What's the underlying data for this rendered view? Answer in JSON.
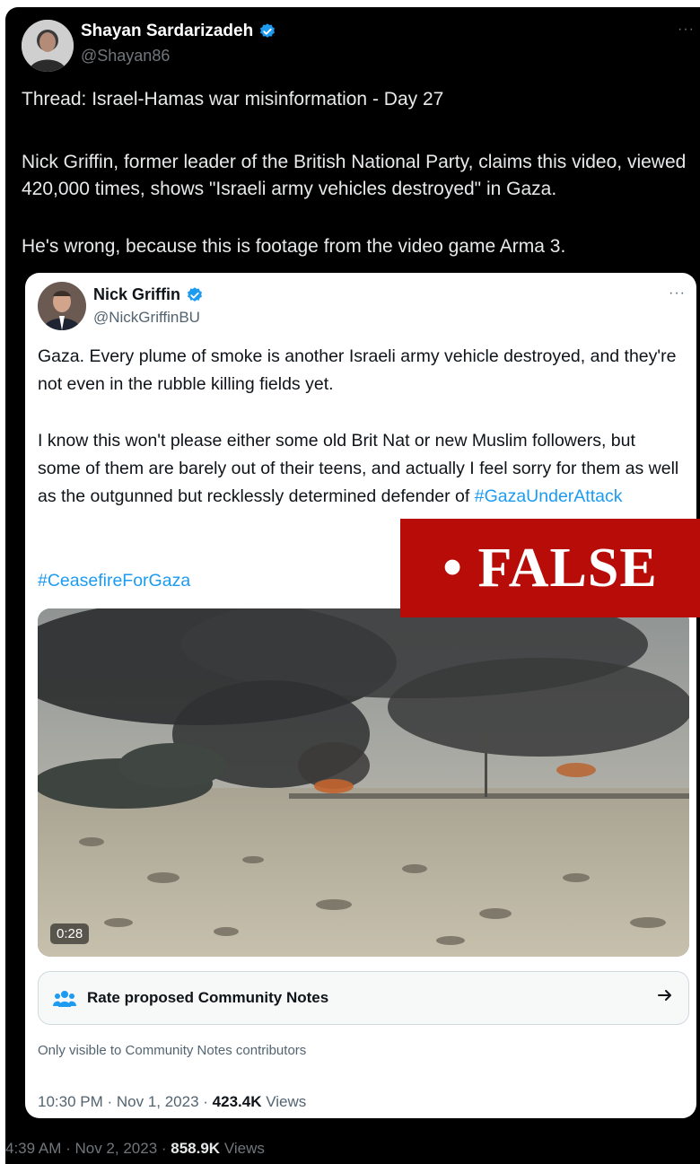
{
  "tweet": {
    "author_name": "Shayan Sardarizadeh",
    "author_handle": "@Shayan86",
    "more": "···",
    "paragraphs": [
      "Thread: Israel-Hamas war misinformation - Day 27",
      "Nick Griffin, former leader of the British National Party, claims this video, viewed 420,000 times, shows \"Israeli army vehicles destroyed\" in Gaza.",
      "He's wrong, because this is footage from the video game Arma 3."
    ],
    "time": "4:39 AM · Nov 2, 2023 · ",
    "views_count": "858.9K",
    "views_label": " Views"
  },
  "quote": {
    "author_name": "Nick Griffin",
    "author_handle": "@NickGriffinBU",
    "more": "···",
    "paragraph1": "Gaza. Every plume of smoke is another Israeli army vehicle destroyed, and they're not even in the rubble killing fields yet.",
    "paragraph2_text": "I know this won't please either some old Brit Nat  or new Muslim followers, but some of them are barely out of their teens, and actually I feel sorry for them as well as the outgunned but recklessly determined defender of ",
    "paragraph2_hashtag": "#GazaUnderAttack",
    "hashtag2": "#CeasefireForGaza",
    "video_duration": "0:28",
    "community_notes_label": "Rate proposed Community Notes",
    "community_notes_note": "Only visible to Community Notes contributors",
    "time": "10:30 PM · Nov 1, 2023 · ",
    "views_count": "423.4K",
    "views_label": " Views"
  },
  "overlay": {
    "false_label": "• FALSE"
  },
  "colors": {
    "verified": "#1d9bf0",
    "hashtag": "#1d9bf0",
    "false_banner": "#b80c09"
  },
  "icons": {
    "verified": "verified-badge-icon",
    "community_notes": "people-group-icon",
    "arrow": "arrow-right-icon"
  }
}
